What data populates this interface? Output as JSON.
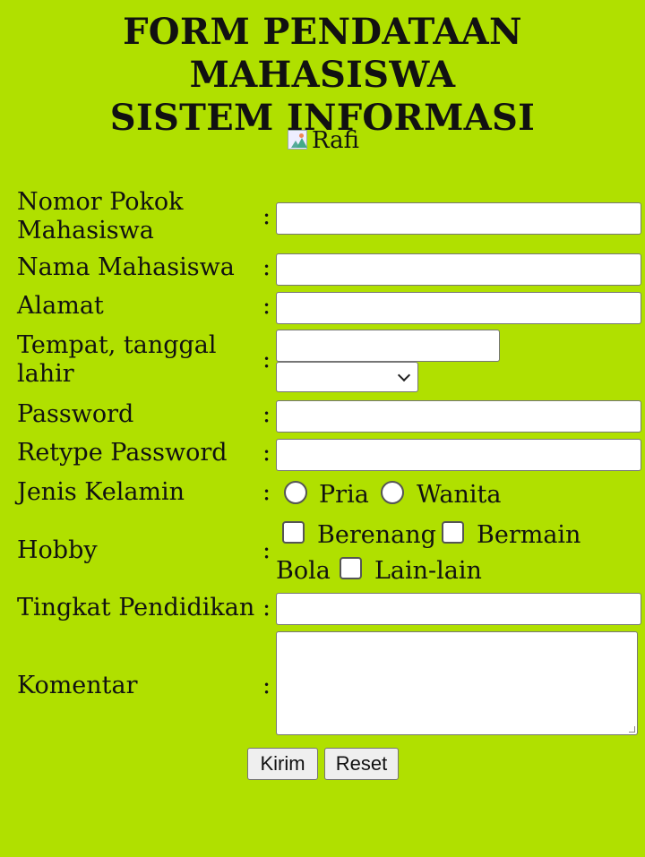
{
  "header": {
    "title_line1": "FORM PENDATAAN MAHASISWA",
    "title_line2": "SISTEM INFORMASI"
  },
  "photo": {
    "alt_text": "Rafi",
    "icon": "broken-image-icon"
  },
  "form": {
    "colon": ":",
    "npm_label_line1": "Nomor Pokok",
    "npm_label_line2": "Mahasiswa",
    "npm_value": "",
    "nama_label": "Nama Mahasiswa",
    "nama_value": "",
    "alamat_label": "Alamat",
    "alamat_value": "",
    "ttl_label_line1": "Tempat, tanggal",
    "ttl_label_line2": "lahir",
    "tempat_value": "",
    "tanggal_selected": "",
    "password_label": "Password",
    "password_value": "",
    "retype_label": "Retype Password",
    "retype_value": "",
    "gender_label": "Jenis Kelamin",
    "gender_options": [
      "Pria",
      "Wanita"
    ],
    "hobby_label": "Hobby",
    "hobby_options": [
      "Berenang",
      "Bermain Bola",
      "Lain-lain"
    ],
    "hobby_bermain_part1": "Bermain",
    "hobby_bermain_part2": "Bola",
    "pendidikan_label": "Tingkat Pendidikan",
    "pendidikan_value": "",
    "komentar_label": "Komentar",
    "komentar_value": ""
  },
  "buttons": {
    "submit": "Kirim",
    "reset": "Reset"
  },
  "colors": {
    "background": "#b0e000"
  }
}
